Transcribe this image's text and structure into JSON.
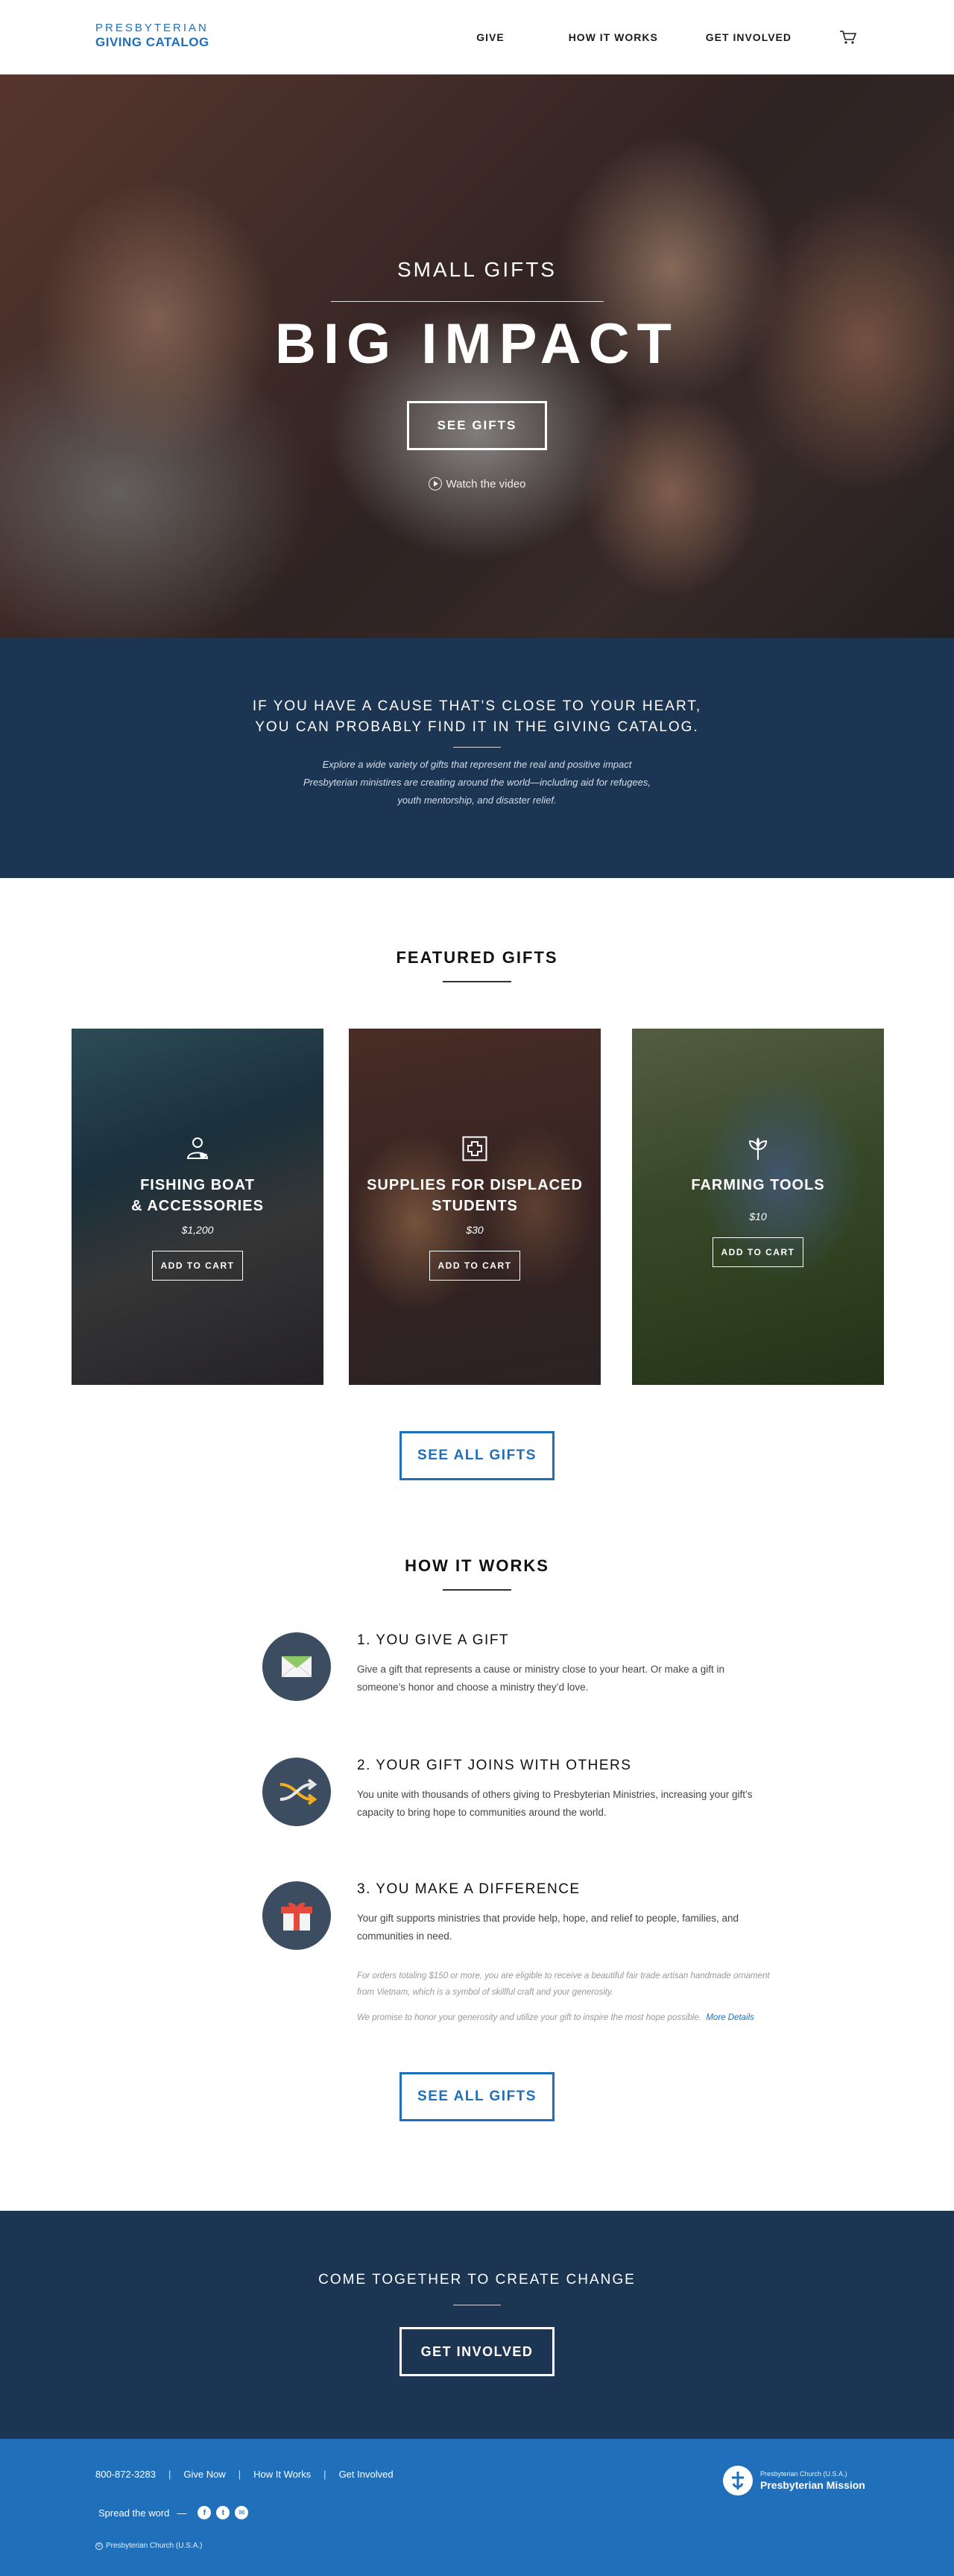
{
  "header": {
    "logo_line1": "PRESBYTERIAN",
    "logo_line2": "GIVING CATALOG",
    "nav": [
      "GIVE",
      "HOW IT WORKS",
      "GET INVOLVED"
    ],
    "cart_icon": "cart-icon"
  },
  "hero": {
    "subtitle": "SMALL GIFTS",
    "title": "BIG IMPACT",
    "button": "SEE GIFTS",
    "video_link": "Watch the video"
  },
  "intro": {
    "heading": "IF YOU HAVE A CAUSE THAT’S CLOSE TO YOUR HEART, YOU CAN PROBABLY FIND IT IN THE GIVING CATALOG.",
    "body": "Explore a wide variety of gifts that represent the real and positive impact Presbyterian ministires are creating around the world—including aid for refugees, youth mentorship, and disaster relief."
  },
  "featured": {
    "title": "FEATURED GIFTS",
    "cards": [
      {
        "name_line1": "FISHING BOAT",
        "name_line2": "& ACCESSORIES",
        "price": "$1,200",
        "button": "ADD TO CART",
        "icon": "person-boat-icon"
      },
      {
        "name_line1": "SUPPLIES FOR DISPLACED",
        "name_line2": "STUDENTS",
        "price": "$30",
        "button": "ADD TO CART",
        "icon": "medical-cross-icon"
      },
      {
        "name_line1": "FARMING TOOLS",
        "name_line2": "",
        "price": "$10",
        "button": "ADD TO CART",
        "icon": "sprout-icon"
      }
    ],
    "see_all": "SEE ALL GIFTS"
  },
  "how": {
    "title": "HOW IT WORKS",
    "steps": [
      {
        "title": "1. YOU GIVE A GIFT",
        "text": "Give a gift that represents a cause or ministry close to your heart. Or make a gift in someone’s honor and choose a ministry they’d love.",
        "icon": "envelope-icon"
      },
      {
        "title": "2. YOUR GIFT JOINS WITH OTHERS",
        "text": "You unite with thousands of others giving to Presbyterian Ministries, increasing your gift’s capacity to bring hope to communities around the world.",
        "icon": "merge-arrows-icon"
      },
      {
        "title": "3. YOU MAKE A DIFFERENCE",
        "text": "Your gift supports ministries that provide help, hope, and relief to people, families, and communities in need.",
        "icon": "gift-box-icon"
      }
    ],
    "fine1": "For orders totaling $150 or more, you are eligible to receive a beautiful fair trade artisan handmade ornament from Vietnam, which is a symbol of skillful craft and your generosity.",
    "fine2": "We promise to honor your generosity and utilize your gift to inspire the most hope possible.",
    "more_details": "More Details",
    "see_all": "SEE ALL GIFTS"
  },
  "cta": {
    "heading": "COME TOGETHER TO CREATE CHANGE",
    "button": "GET INVOLVED"
  },
  "footer": {
    "phone": "800-872-3283",
    "links": [
      "Give Now",
      "How It Works",
      "Get Involved"
    ],
    "spread": "Spread the word",
    "social": [
      "f",
      "t",
      "✉"
    ],
    "copyright": "Presbyterian Church (U.S.A.)",
    "org_small": "Presbyterian Church (U.S.A.)",
    "org_name": "Presbyterian Mission"
  },
  "colors": {
    "brand_blue": "#1f6fba",
    "navy": "#1c3553",
    "step_icon_bg": "#3c4d61"
  }
}
